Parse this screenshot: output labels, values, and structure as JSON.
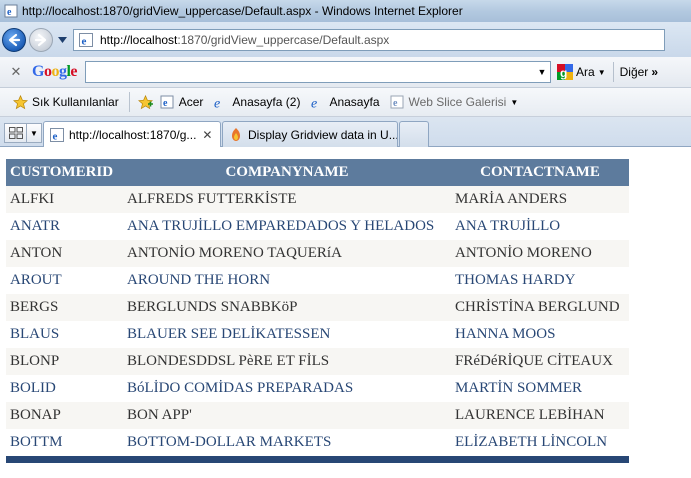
{
  "window": {
    "title": "http://localhost:1870/gridView_uppercase/Default.aspx - Windows Internet Explorer"
  },
  "address_bar": {
    "url_host": "http://localhost",
    "url_rest": ":1870/gridView_uppercase/Default.aspx"
  },
  "google_toolbar": {
    "logo_parts": [
      "G",
      "o",
      "o",
      "g",
      "l",
      "e"
    ],
    "search_value": "",
    "search_button": "Ara",
    "more_button": "Diğer"
  },
  "favorites_bar": {
    "favorites_label": "Sık Kullanılanlar",
    "items": [
      {
        "label": "Acer"
      },
      {
        "label": "Anasayfa (2)"
      },
      {
        "label": "Anasayfa"
      },
      {
        "label": "Web Slice Galerisi"
      }
    ]
  },
  "tabs": [
    {
      "label": "http://localhost:1870/g...",
      "active": true
    },
    {
      "label": "Display Gridview data in U...",
      "active": false
    }
  ],
  "grid": {
    "headers": [
      "CUSTOMERID",
      "COMPANYNAME",
      "CONTACTNAME"
    ],
    "rows": [
      [
        "ALFKI",
        "ALFREDS FUTTERKİSTE",
        "MARİA ANDERS"
      ],
      [
        "ANATR",
        "ANA TRUJİLLO EMPAREDADOS Y HELADOS",
        "ANA TRUJİLLO"
      ],
      [
        "ANTON",
        "ANTONİO MORENO TAQUERíA",
        "ANTONİO MORENO"
      ],
      [
        "AROUT",
        "AROUND THE HORN",
        "THOMAS HARDY"
      ],
      [
        "BERGS",
        "BERGLUNDS SNABBKöP",
        "CHRİSTİNA BERGLUND"
      ],
      [
        "BLAUS",
        "BLAUER SEE DELİKATESSEN",
        "HANNA MOOS"
      ],
      [
        "BLONP",
        "BLONDESDDSL PèRE ET FİLS",
        "FRéDéRİQUE CİTEAUX"
      ],
      [
        "BOLID",
        "BóLİDO COMİDAS PREPARADAS",
        "MARTİN SOMMER"
      ],
      [
        "BONAP",
        "BON APP'",
        "LAURENCE LEBİHAN"
      ],
      [
        "BOTTM",
        "BOTTOM-DOLLAR MARKETS",
        "ELİZABETH LİNCOLN"
      ]
    ]
  },
  "colors": {
    "header_bg": "#5d7b9d",
    "footer_bg": "#284775",
    "row_alt_bg": "#f7f6f3",
    "row_text": "#333333",
    "row_alt_text": "#284775"
  },
  "icons": {
    "title": "ie-page-icon",
    "back": "back-arrow-icon",
    "forward": "forward-arrow-icon",
    "favorites": "star-icon",
    "add_favorite": "add-favorite-star-icon",
    "google": "google-mini-icon"
  }
}
